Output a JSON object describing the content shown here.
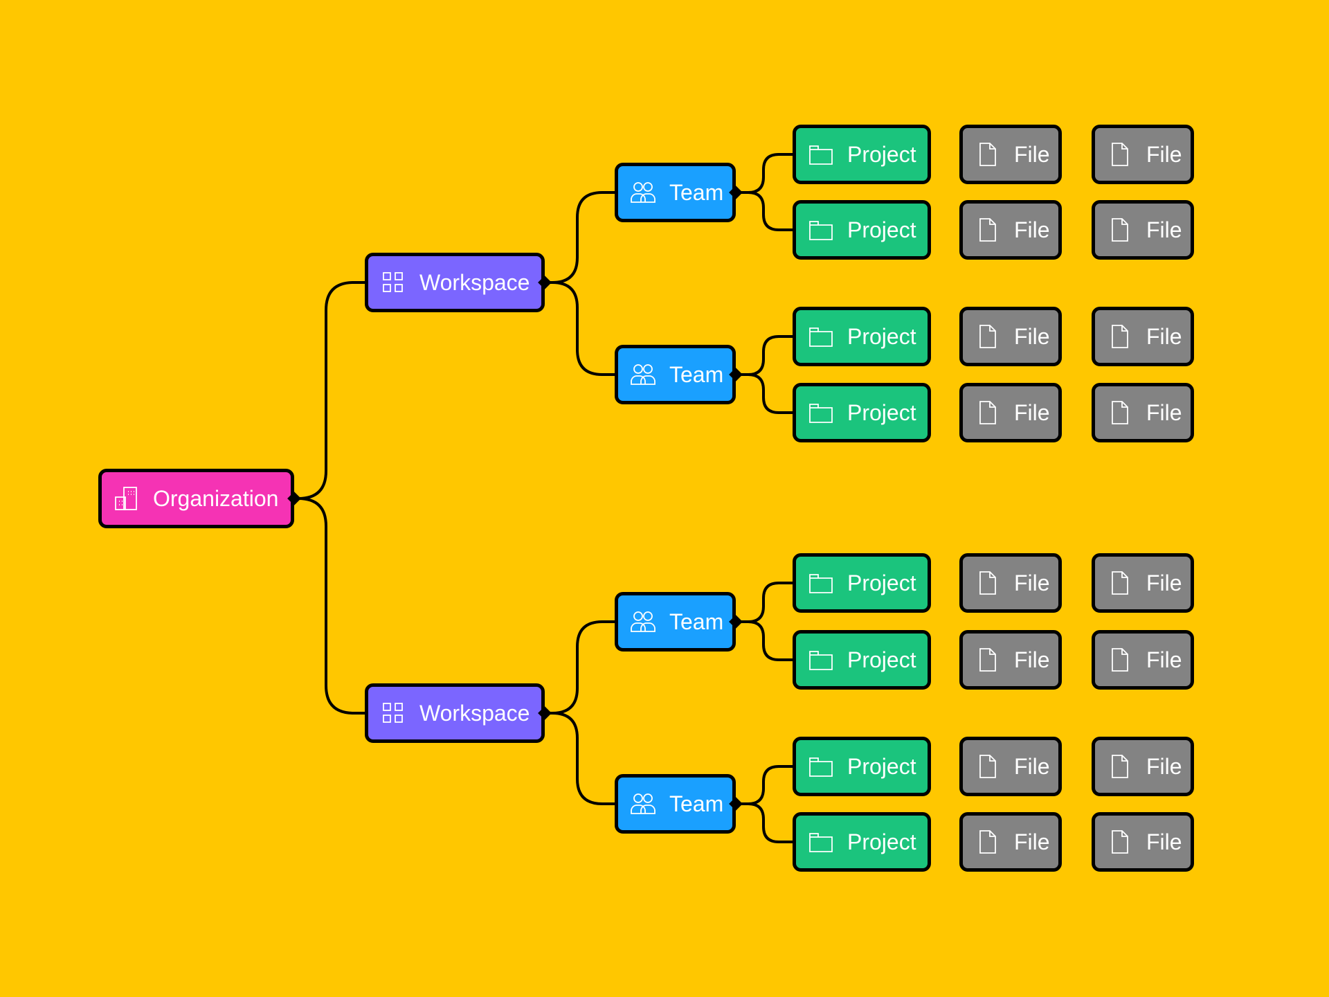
{
  "colors": {
    "background": "#FFC700",
    "organization": "#F533B4",
    "workspace": "#7B66FF",
    "team": "#1AA0FF",
    "project": "#1BC47D",
    "file": "#838383",
    "line": "#000000"
  },
  "tree": {
    "label": "Organization",
    "icon": "building-icon",
    "workspaces": [
      {
        "label": "Workspace",
        "icon": "grid-icon",
        "teams": [
          {
            "label": "Team",
            "icon": "users-icon",
            "projects": [
              {
                "label": "Project",
                "icon": "folder-icon",
                "files": [
                  {
                    "label": "File",
                    "icon": "file-icon"
                  },
                  {
                    "label": "File",
                    "icon": "file-icon"
                  }
                ]
              },
              {
                "label": "Project",
                "icon": "folder-icon",
                "files": [
                  {
                    "label": "File",
                    "icon": "file-icon"
                  },
                  {
                    "label": "File",
                    "icon": "file-icon"
                  }
                ]
              }
            ]
          },
          {
            "label": "Team",
            "icon": "users-icon",
            "projects": [
              {
                "label": "Project",
                "icon": "folder-icon",
                "files": [
                  {
                    "label": "File",
                    "icon": "file-icon"
                  },
                  {
                    "label": "File",
                    "icon": "file-icon"
                  }
                ]
              },
              {
                "label": "Project",
                "icon": "folder-icon",
                "files": [
                  {
                    "label": "File",
                    "icon": "file-icon"
                  },
                  {
                    "label": "File",
                    "icon": "file-icon"
                  }
                ]
              }
            ]
          }
        ]
      },
      {
        "label": "Workspace",
        "icon": "grid-icon",
        "teams": [
          {
            "label": "Team",
            "icon": "users-icon",
            "projects": [
              {
                "label": "Project",
                "icon": "folder-icon",
                "files": [
                  {
                    "label": "File",
                    "icon": "file-icon"
                  },
                  {
                    "label": "File",
                    "icon": "file-icon"
                  }
                ]
              },
              {
                "label": "Project",
                "icon": "folder-icon",
                "files": [
                  {
                    "label": "File",
                    "icon": "file-icon"
                  },
                  {
                    "label": "File",
                    "icon": "file-icon"
                  }
                ]
              }
            ]
          },
          {
            "label": "Team",
            "icon": "users-icon",
            "projects": [
              {
                "label": "Project",
                "icon": "folder-icon",
                "files": [
                  {
                    "label": "File",
                    "icon": "file-icon"
                  },
                  {
                    "label": "File",
                    "icon": "file-icon"
                  }
                ]
              },
              {
                "label": "Project",
                "icon": "folder-icon",
                "files": [
                  {
                    "label": "File",
                    "icon": "file-icon"
                  },
                  {
                    "label": "File",
                    "icon": "file-icon"
                  }
                ]
              }
            ]
          }
        ]
      }
    ]
  }
}
